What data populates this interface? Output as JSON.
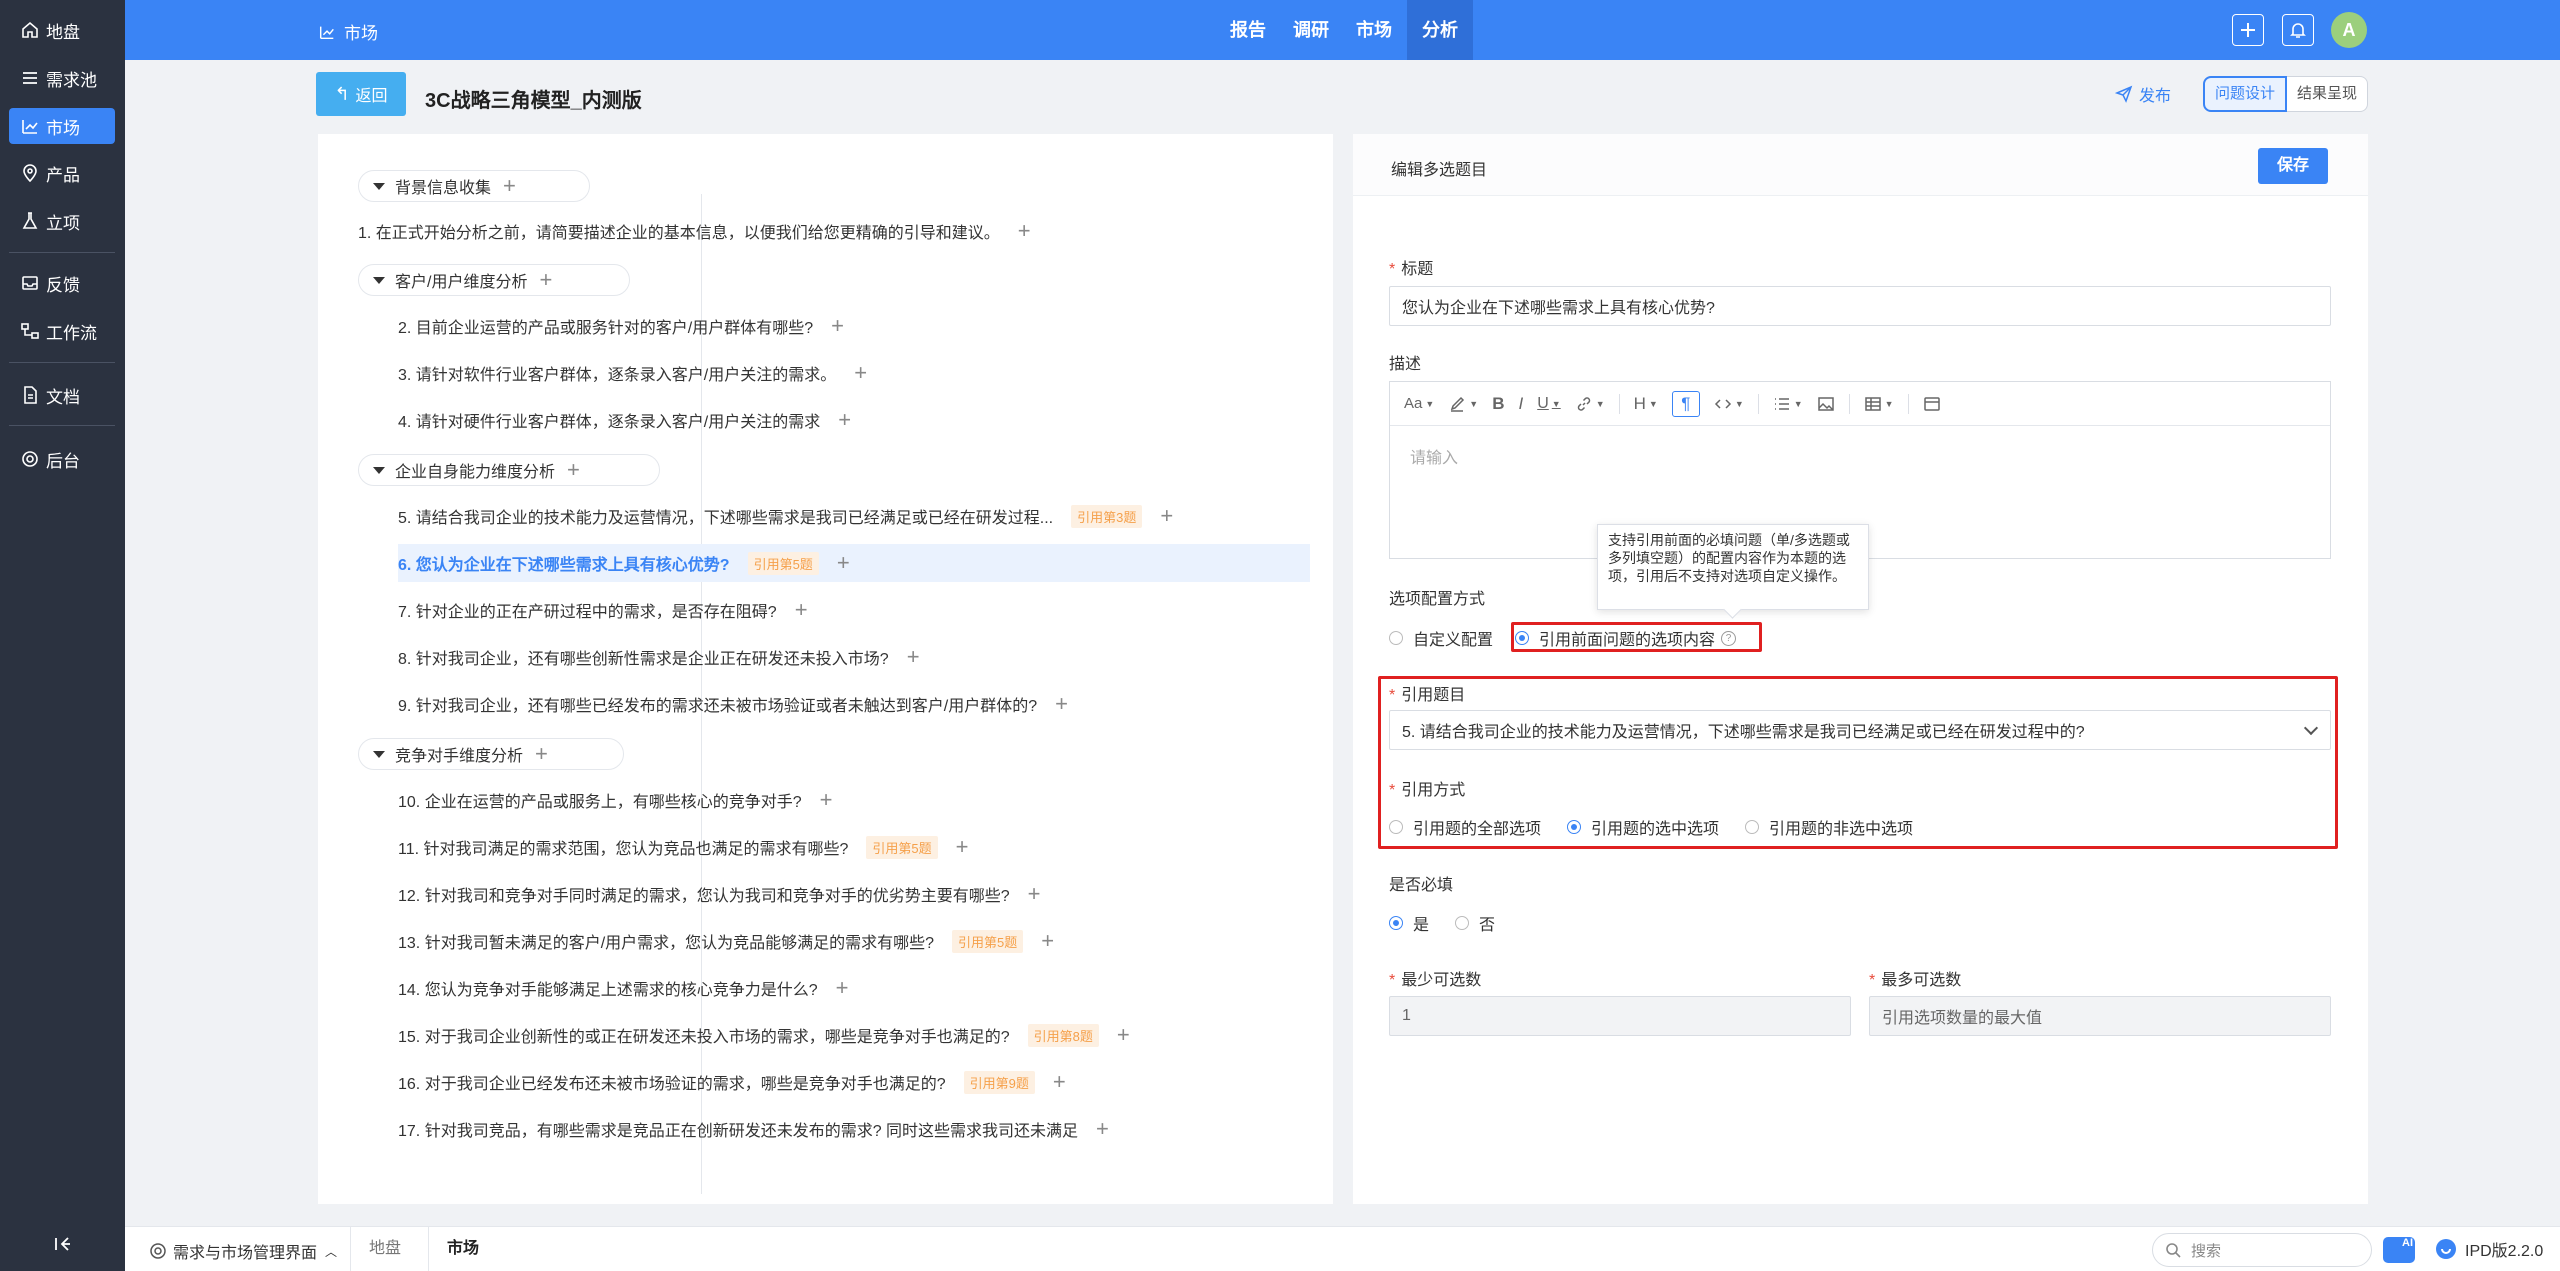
{
  "nav": {
    "items": [
      {
        "label": "地盘",
        "icon": "home-icon"
      },
      {
        "label": "需求池",
        "icon": "list-icon"
      },
      {
        "label": "市场",
        "icon": "chart-icon"
      },
      {
        "label": "产品",
        "icon": "location-pin-icon"
      },
      {
        "label": "立项",
        "icon": "flask-icon"
      },
      {
        "label": "反馈",
        "icon": "inbox-icon"
      },
      {
        "label": "工作流",
        "icon": "workflow-icon"
      },
      {
        "label": "文档",
        "icon": "document-icon"
      },
      {
        "label": "后台",
        "icon": "gear-icon"
      }
    ],
    "active": "市场"
  },
  "topbar": {
    "title": "市场",
    "tabs": [
      "报告",
      "调研",
      "市场",
      "分析"
    ],
    "active_tab": "分析",
    "avatar_letter": "A"
  },
  "header": {
    "back_label": "返回",
    "page_title": "3C战略三角模型_内测版",
    "publish_label": "发布",
    "view_tabs": [
      "问题设计",
      "结果呈现"
    ],
    "active_view": "问题设计"
  },
  "tree": {
    "groups": [
      {
        "title": "背景信息收集"
      },
      {
        "title": "客户/用户维度分析"
      },
      {
        "title": "企业自身能力维度分析"
      },
      {
        "title": "竞争对手维度分析"
      }
    ],
    "questions": [
      {
        "text": "1. 在正式开始分析之前，请简要描述企业的基本信息，以便我们给您更精确的引导和建议。",
        "ref": ""
      },
      {
        "text": "2. 目前企业运营的产品或服务针对的客户/用户群体有哪些?",
        "ref": ""
      },
      {
        "text": "3. 请针对软件行业客户群体，逐条录入客户/用户关注的需求。",
        "ref": ""
      },
      {
        "text": "4. 请针对硬件行业客户群体，逐条录入客户/用户关注的需求",
        "ref": ""
      },
      {
        "text": "5. 请结合我司企业的技术能力及运营情况，下述哪些需求是我司已经满足或已经在研发过程...",
        "ref": "引用第3题"
      },
      {
        "text": "6. 您认为企业在下述哪些需求上具有核心优势?",
        "ref": "引用第5题"
      },
      {
        "text": "7. 针对企业的正在产研过程中的需求，是否存在阻碍?",
        "ref": ""
      },
      {
        "text": "8. 针对我司企业，还有哪些创新性需求是企业正在研发还未投入市场?",
        "ref": ""
      },
      {
        "text": "9. 针对我司企业，还有哪些已经发布的需求还未被市场验证或者未触达到客户/用户群体的?",
        "ref": ""
      },
      {
        "text": "10. 企业在运营的产品或服务上，有哪些核心的竞争对手?",
        "ref": ""
      },
      {
        "text": "11. 针对我司满足的需求范围，您认为竞品也满足的需求有哪些?",
        "ref": "引用第5题"
      },
      {
        "text": "12. 针对我司和竞争对手同时满足的需求，您认为我司和竞争对手的优劣势主要有哪些?",
        "ref": ""
      },
      {
        "text": "13. 针对我司暂未满足的客户/用户需求，您认为竞品能够满足的需求有哪些?",
        "ref": "引用第5题"
      },
      {
        "text": "14. 您认为竞争对手能够满足上述需求的核心竞争力是什么?",
        "ref": ""
      },
      {
        "text": "15. 对于我司企业创新性的或正在研发还未投入市场的需求，哪些是竞争对手也满足的?",
        "ref": "引用第8题"
      },
      {
        "text": "16. 对于我司企业已经发布还未被市场验证的需求，哪些是竞争对手也满足的?",
        "ref": "引用第9题"
      },
      {
        "text": "17. 针对我司竞品，有哪些需求是竞品正在创新研发还未发布的需求? 同时这些需求我司还未满足",
        "ref": ""
      }
    ],
    "selected_index": 5
  },
  "editor": {
    "header_title": "编辑多选题目",
    "save_label": "保存",
    "title_label": "标题",
    "title_value": "您认为企业在下述哪些需求上具有核心优势?",
    "desc_label": "描述",
    "desc_placeholder": "请输入",
    "option_config_label": "选项配置方式",
    "option_config": [
      "自定义配置",
      "引用前面问题的选项内容"
    ],
    "option_config_selected": "引用前面问题的选项内容",
    "tooltip_text": "支持引用前面的必填问题（单/多选题或多列填空题）的配置内容作为本题的选项，引用后不支持对选项自定义操作。",
    "ref_question_label": "引用题目",
    "ref_question_value": "5. 请结合我司企业的技术能力及运营情况，下述哪些需求是我司已经满足或已经在研发过程中的?",
    "ref_mode_label": "引用方式",
    "ref_modes": [
      "引用题的全部选项",
      "引用题的选中选项",
      "引用题的非选中选项"
    ],
    "ref_mode_selected": "引用题的选中选项",
    "required_label": "是否必填",
    "required_options": [
      "是",
      "否"
    ],
    "required_selected": "是",
    "min_label": "最少可选数",
    "min_value": "1",
    "max_label": "最多可选数",
    "max_value": "引用选项数量的最大值",
    "toolbar_heading": "Aa"
  },
  "bottom": {
    "app_label": "需求与市场管理界面",
    "tabs": [
      "地盘",
      "市场"
    ],
    "active_tab": "市场",
    "search_placeholder": "搜索",
    "version": "IPD版2.2.0",
    "ai_badge": "AI"
  },
  "colors": {
    "primary": "#3a84f5",
    "nav_bg": "#2b3240",
    "highlight_red": "#e02020",
    "ref_badge": "#f5a04a"
  }
}
